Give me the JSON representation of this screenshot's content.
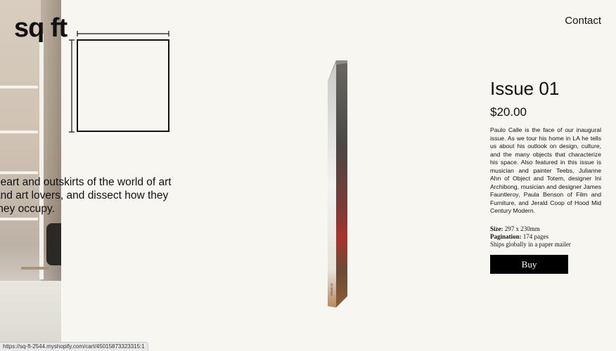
{
  "brand": {
    "logo": "sq ft"
  },
  "header": {
    "contact_label": "Contact"
  },
  "intro": {
    "lines": [
      "heart and outskirts of the world of art",
      "and art lovers, and dissect how they",
      "they occupy."
    ]
  },
  "product": {
    "title": "Issue 01",
    "price": "$20.00",
    "description": "Paulo Calle is the face of our inaugural issue. As we tour his home in LA he tells us about his outlook on design, culture, and the many objects that characterize his space. Also featured in this issue is musician and painter Teebs, Julianne Ahn of Object and Totem, designer Ini Archibong, musician and designer James Fauntleroy, Paula Benson of Film and Furniture, and Jerald Coop of Hood Mid Century Modern.",
    "specs": {
      "size_label": "Size:",
      "size_value": "297 x 230mm",
      "pagination_label": "Pagination:",
      "pagination_value": "174 pages",
      "shipping": "Ships globally in a paper mailer"
    },
    "buy_label": "Buy",
    "spine_text": "ISSUE 01"
  },
  "status_bar": {
    "url": "https://sq-ft-2544.myshopify.com/cart/45015873323315:1"
  },
  "colors": {
    "background": "#f8f6f1",
    "button": "#000000",
    "button_text": "#ffffff"
  }
}
